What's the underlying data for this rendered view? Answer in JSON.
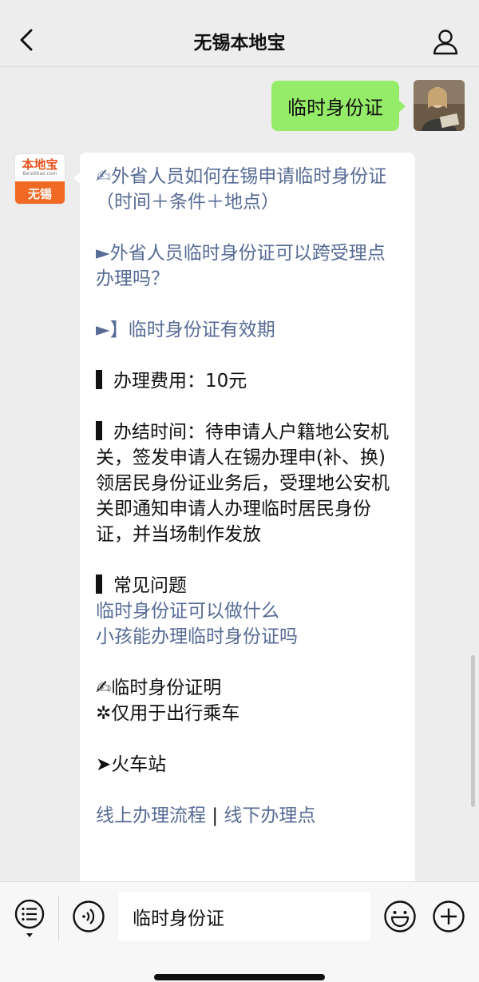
{
  "header": {
    "title": "无锡本地宝",
    "back_icon": "chevron-left-icon",
    "profile_icon": "person-icon"
  },
  "user_message": {
    "text": "临时身份证"
  },
  "bot_avatar": {
    "brand": "本地宝",
    "url": "Bendibao.com",
    "city": "无锡"
  },
  "bot_message": {
    "item1": "✍外省人员如何在锡申请临时身份证（时间＋条件＋地点）",
    "item2": "►外省人员临时身份证可以跨受理点办理吗？",
    "item3": "►】临时身份证有效期",
    "fee": "办理费用：10元",
    "time": "办结时间：待申请人户籍地公安机关，签发申请人在锡办理申(补、换)领居民身份证业务后，受理地公安机关即通知申请人办理临时居民身份证，并当场制作发放",
    "faq_title": "常见问题",
    "faq1": "临时身份证可以做什么",
    "faq2": "小孩能办理临时身份证吗",
    "proof_title": "✍临时身份证明",
    "proof_note": "✲仅用于出行乘车",
    "station": "➤火车站",
    "online": "线上办理流程",
    "separator": "|",
    "offline": "线下办理点"
  },
  "input_bar": {
    "text": "临时身份证",
    "menu_icon": "list-menu-icon",
    "voice_icon": "voice-icon",
    "emoji_icon": "emoji-icon",
    "plus_icon": "plus-icon"
  },
  "colors": {
    "background": "#ededed",
    "user_bubble": "#95ec69",
    "link": "#576b95",
    "brand_orange": "#f06a26"
  }
}
